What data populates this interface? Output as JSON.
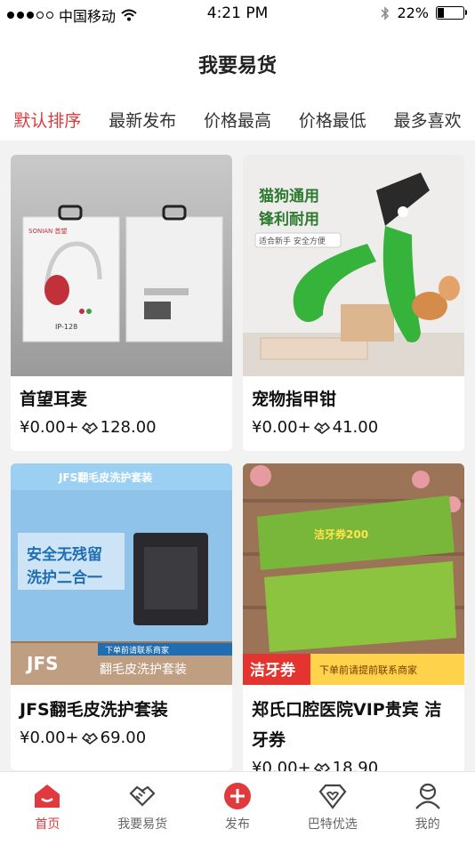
{
  "status_bar": {
    "carrier": "中国移动",
    "time": "4:21 PM",
    "battery": "22%"
  },
  "header": {
    "title": "我要易货"
  },
  "sort_tabs": [
    {
      "label": "默认排序",
      "active": true
    },
    {
      "label": "最新发布",
      "active": false
    },
    {
      "label": "价格最高",
      "active": false
    },
    {
      "label": "价格最低",
      "active": false
    },
    {
      "label": "最多喜欢",
      "active": false
    }
  ],
  "products": [
    {
      "title": "首望耳麦",
      "price": "¥0.00+",
      "barter_price": "128.00",
      "image": {
        "brand_text": "SONIAN 首望",
        "model_text": "IP-128"
      }
    },
    {
      "title": "宠物指甲钳",
      "price": "¥0.00+",
      "barter_price": "41.00",
      "image": {
        "headline_1": "猫狗通用",
        "headline_2": "锋利耐用",
        "tag": "适合新手 安全方便"
      }
    },
    {
      "title": "JFS翻毛皮洗护套装",
      "price": "¥0.00+",
      "barter_price": "69.00",
      "image": {
        "banner": "JFS翻毛皮洗护套装",
        "line_1": "安全无残留",
        "line_2": "洗护二合一",
        "ribbon": "下单前请联系商家",
        "logo": "JFS",
        "subtitle": "翻毛皮洗护套装"
      }
    },
    {
      "title": "郑氏口腔医院VIP贵宾 洁牙券",
      "price": "¥0.00+",
      "barter_price": "18.90",
      "image": {
        "coupon_label": "洁牙券",
        "ribbon": "下单前请提前联系商家",
        "coupon_value": "洁牙券200"
      }
    }
  ],
  "tabbar": [
    {
      "label": "首页",
      "icon": "home-icon",
      "active": true
    },
    {
      "label": "我要易货",
      "icon": "handshake-icon",
      "active": false
    },
    {
      "label": "发布",
      "icon": "plus-circle-icon",
      "active": false
    },
    {
      "label": "巴特优选",
      "icon": "heart-gem-icon",
      "active": false
    },
    {
      "label": "我的",
      "icon": "user-icon",
      "active": false
    }
  ],
  "colors": {
    "accent": "#e0393e",
    "active_sort": "#d9393a",
    "background": "#f2f2f2"
  }
}
